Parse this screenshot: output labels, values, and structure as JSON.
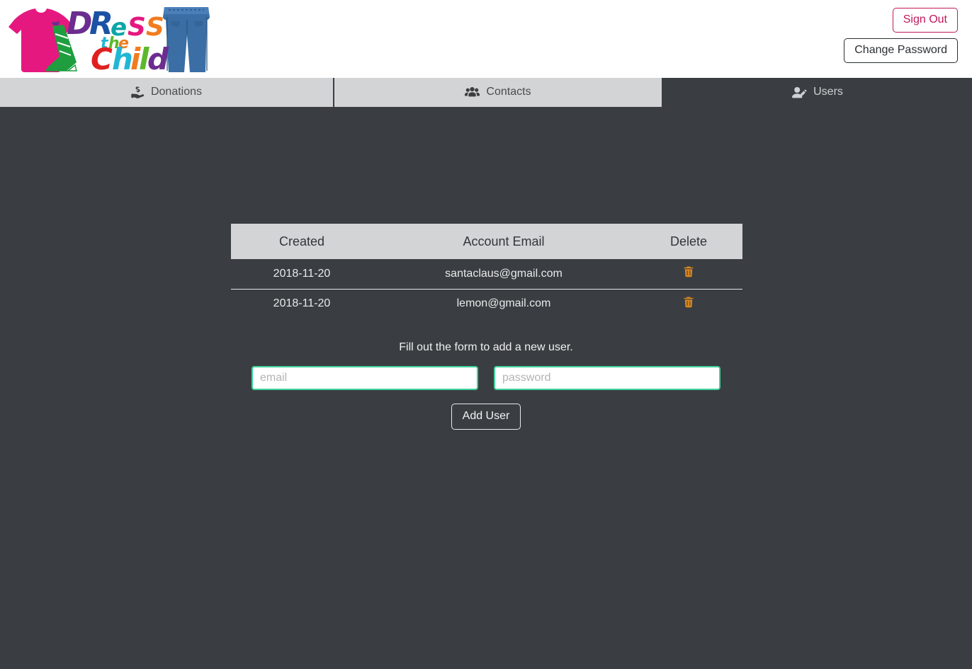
{
  "brand": {
    "logo_name": "dress-the-child-logo",
    "logo_text_lines": [
      "DReSS",
      "the",
      "Child"
    ],
    "colors": {
      "shirt_pink": "#e5187f",
      "jeans_blue": "#3a6ea5",
      "shoe_green": "#1e9e3e",
      "letter_purple": "#6b2d8f",
      "letter_blue": "#1b52a4",
      "letter_teal": "#0aa6a6",
      "letter_magenta": "#e5187f",
      "letter_orange": "#f07c1f",
      "letter_red": "#e02020",
      "letter_cyan": "#22b6d6",
      "letter_green": "#5cb82b"
    }
  },
  "header": {
    "sign_out_label": "Sign Out",
    "change_password_label": "Change Password",
    "sign_out_color": "#c2185b",
    "change_password_color": "#2b2f33"
  },
  "tabs": [
    {
      "id": "donations",
      "label": "Donations",
      "icon": "hand-holding-dollar-icon",
      "active": false
    },
    {
      "id": "contacts",
      "label": "Contacts",
      "icon": "users-group-icon",
      "active": false
    },
    {
      "id": "users",
      "label": "Users",
      "icon": "user-edit-icon",
      "active": true
    }
  ],
  "users_table": {
    "columns": [
      "Created",
      "Account Email",
      "Delete"
    ],
    "rows": [
      {
        "created": "2018-11-20",
        "email": "santaclaus@gmail.com",
        "delete_icon": "trash-icon"
      },
      {
        "created": "2018-11-20",
        "email": "lemon@gmail.com",
        "delete_icon": "trash-icon"
      }
    ],
    "header_bg": "#d2d4d6",
    "trash_color": "#d9861f"
  },
  "add_user_form": {
    "hint": "Fill out the form to add a new user.",
    "email_value": "",
    "email_placeholder": "email",
    "password_value": "",
    "password_placeholder": "password",
    "submit_label": "Add User",
    "field_border_color": "#3ed39a"
  },
  "theme": {
    "page_bg": "#3a3e42",
    "header_bg": "#ffffff",
    "tab_inactive_bg": "#d2d4d6"
  }
}
